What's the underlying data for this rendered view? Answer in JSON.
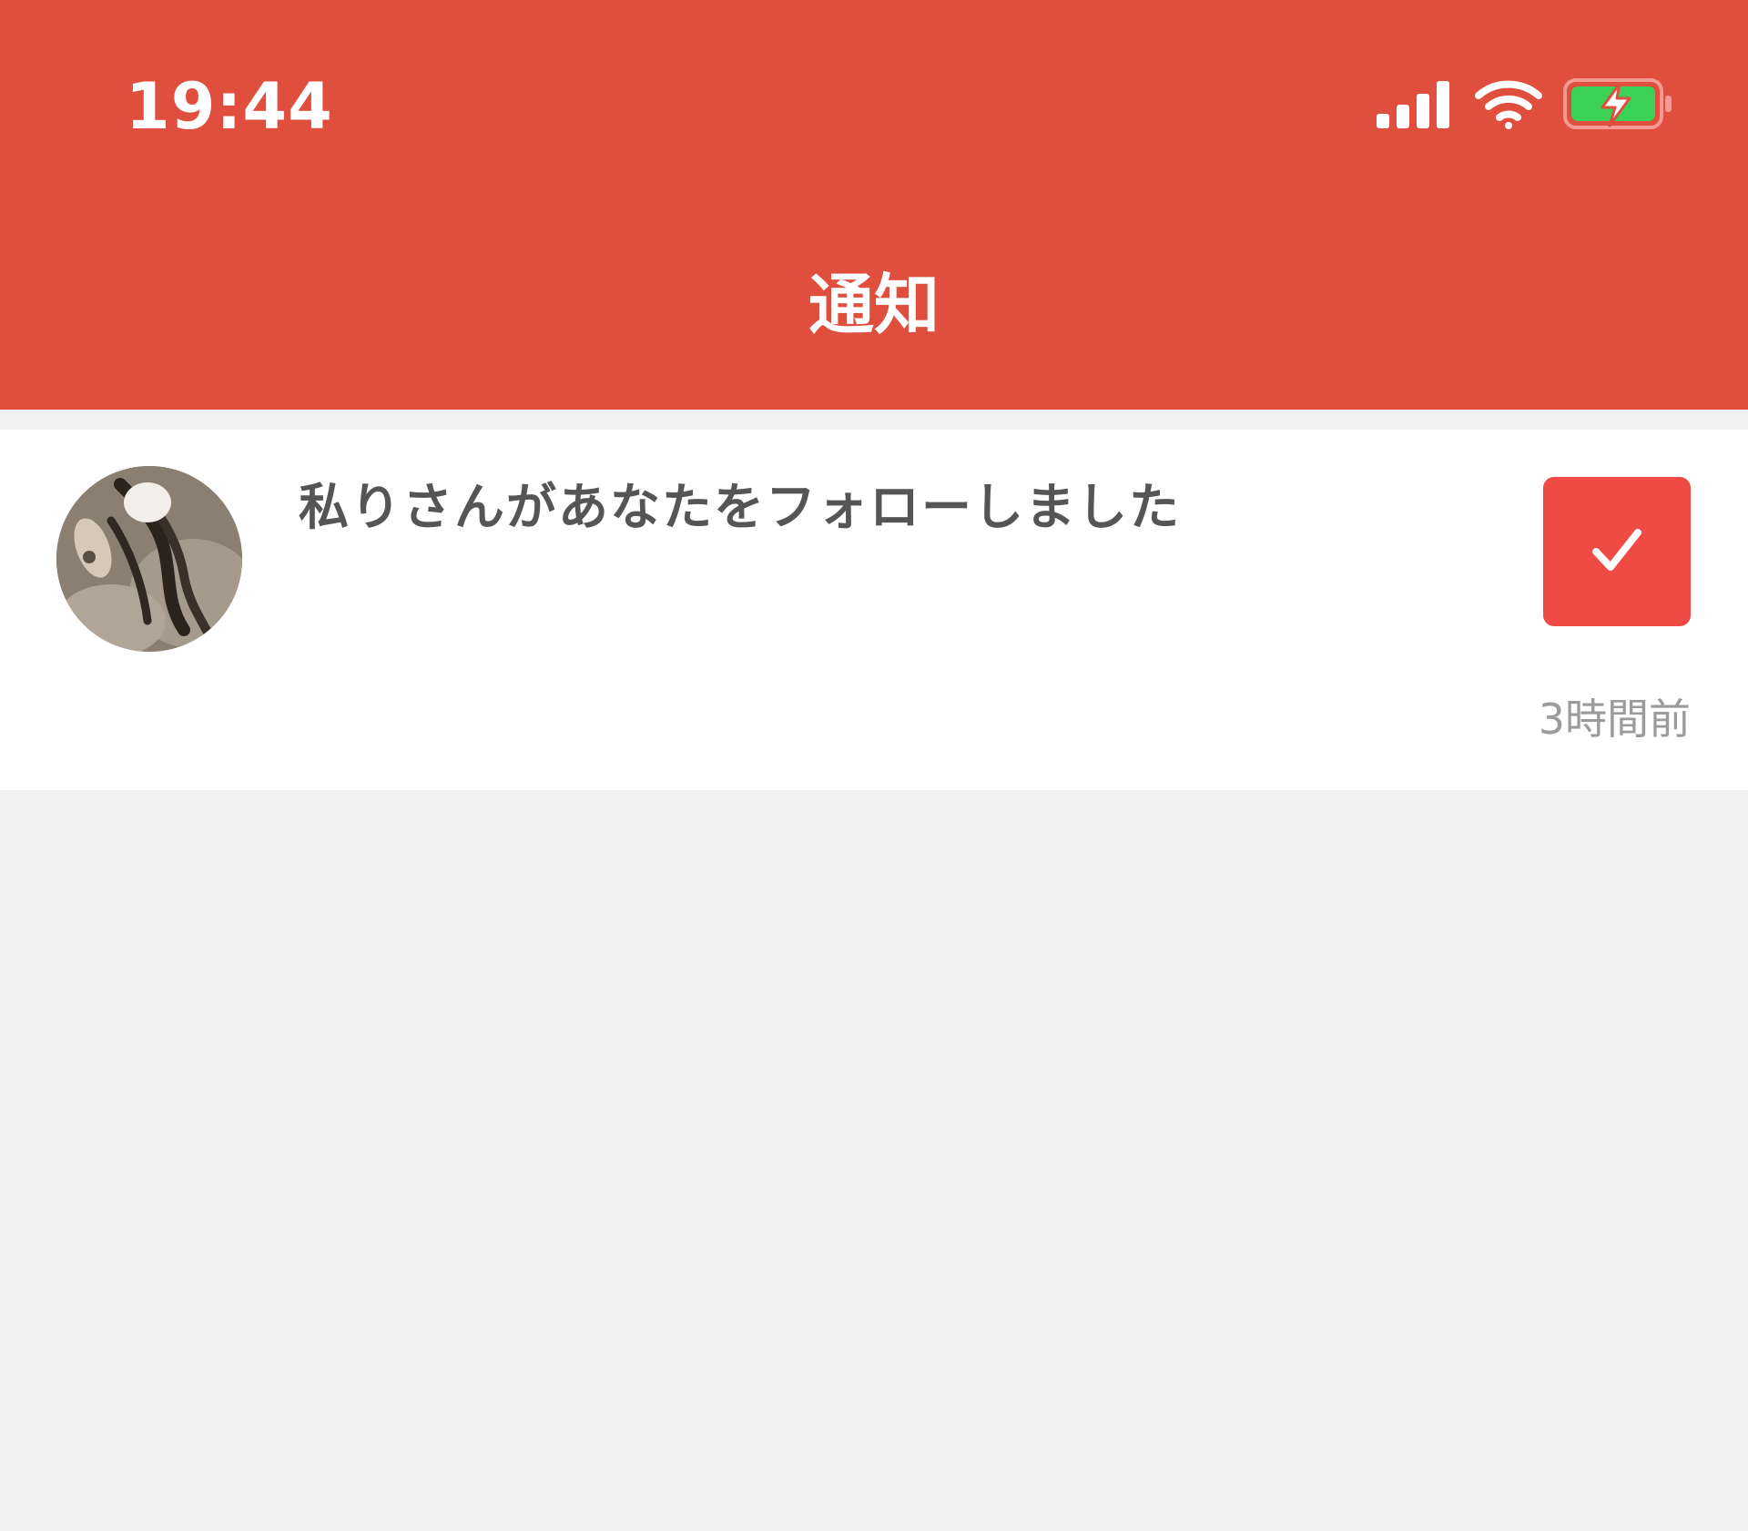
{
  "status_bar": {
    "time": "19:44",
    "icons": [
      "signal-icon",
      "wifi-icon",
      "battery-charging-icon"
    ]
  },
  "header": {
    "title": "通知",
    "background": "#e04e3e"
  },
  "notifications": [
    {
      "avatar": "user-avatar",
      "message": "私りさんがあなたをフォローしました",
      "action_icon": "check-icon",
      "action_color": "#f04a44",
      "time_ago": "3時間前"
    }
  ]
}
